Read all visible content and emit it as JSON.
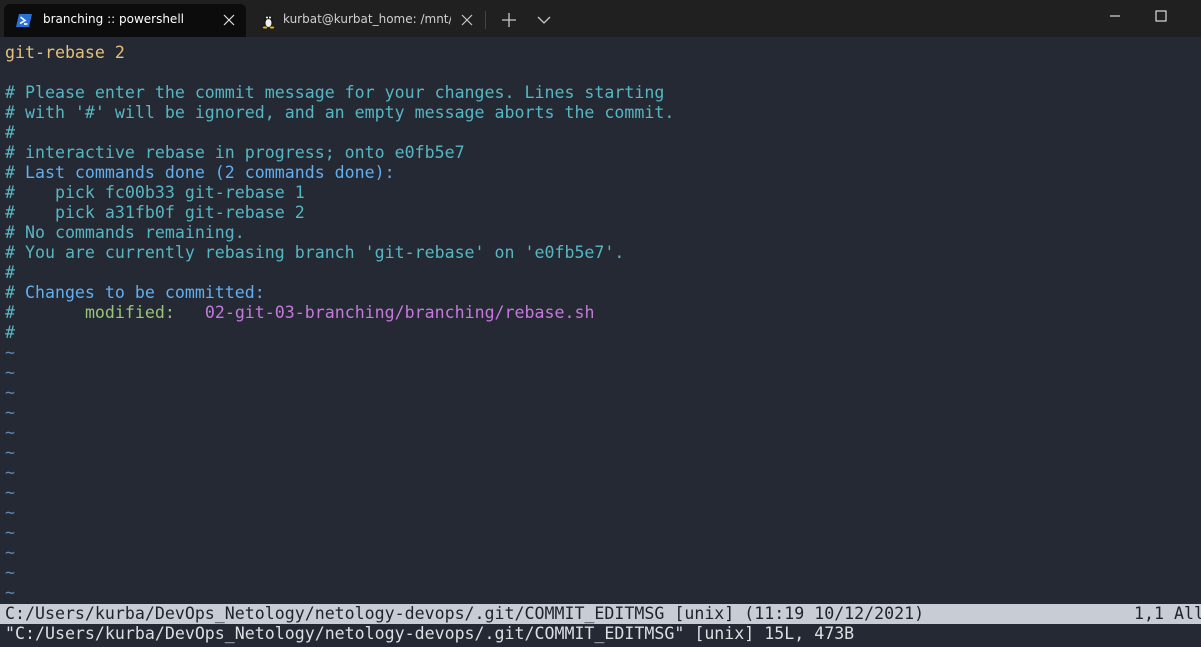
{
  "tabs": [
    {
      "title": "branching :: powershell",
      "icon": "powershell-icon",
      "active": true
    },
    {
      "title": "kurbat@kurbat_home: /mnt/c/U",
      "icon": "linux-icon",
      "active": false
    }
  ],
  "editor": {
    "title_line": "git-rebase 2",
    "comment_lines": [
      "# Please enter the commit message for your changes. Lines starting",
      "# with '#' will be ignored, and an empty message aborts the commit.",
      "#",
      "# interactive rebase in progress; onto e0fb5e7"
    ],
    "last_done_hash": "# ",
    "last_done_label": "Last commands done (2 commands done):",
    "done_commands": [
      "#    pick fc00b33 git-rebase 1",
      "#    pick a31fb0f git-rebase 2"
    ],
    "remaining_line": "# No commands remaining.",
    "rebasing_line": "# You are currently rebasing branch 'git-rebase' on 'e0fb5e7'.",
    "empty_comment_1": "#",
    "changes_hash": "# ",
    "changes_label": "Changes to be committed:",
    "modified_prefix": "#       ",
    "modified_label": "modified:",
    "modified_gap": "   ",
    "modified_path": "02-git-03-branching/branching/rebase.sh",
    "empty_comment_2": "#",
    "tilde": "~"
  },
  "status": {
    "file_info": "C:/Users/kurba/DevOps_Netology/netology-devops/.git/COMMIT_EDITMSG [unix] (11:19 10/12/2021)",
    "position": "1,1 All"
  },
  "message": "\"C:/Users/kurba/DevOps_Netology/netology-devops/.git/COMMIT_EDITMSG\" [unix] 15L, 473B",
  "colors": {
    "background": "#242933",
    "comment": "#56b6c2",
    "keyword": "#61afef",
    "modified": "#98c379",
    "path": "#c678dd",
    "title": "#e5c07b"
  }
}
